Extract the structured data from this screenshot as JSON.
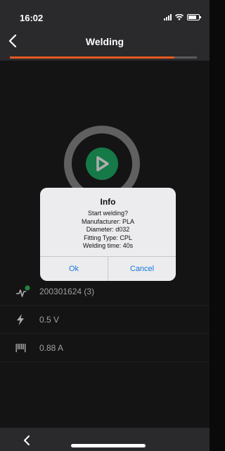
{
  "status_bar": {
    "time": "16:02",
    "battery_level": 0.8
  },
  "header": {
    "title": "Welding",
    "back_icon": "chevron-left-icon"
  },
  "progress": {
    "fraction": 0.88,
    "color": "#e2591f"
  },
  "start_button": {
    "icon": "play-icon",
    "color": "#1fb36b"
  },
  "rows": [
    {
      "icon": "pulse-status-icon",
      "value": "200301624 (3)"
    },
    {
      "icon": "voltage-bolt-icon",
      "value": "0.5 V"
    },
    {
      "icon": "current-gauge-icon",
      "value": "0.88 A"
    }
  ],
  "dialog": {
    "title": "Info",
    "lines": [
      "Start welding?",
      "Manufacturer: PLA",
      "Diameter: d032",
      "Fitting Type: CPL",
      "Welding time: 40s"
    ],
    "ok_label": "Ok",
    "cancel_label": "Cancel"
  },
  "bottom_bar": {
    "back_icon": "chevron-left-icon"
  }
}
